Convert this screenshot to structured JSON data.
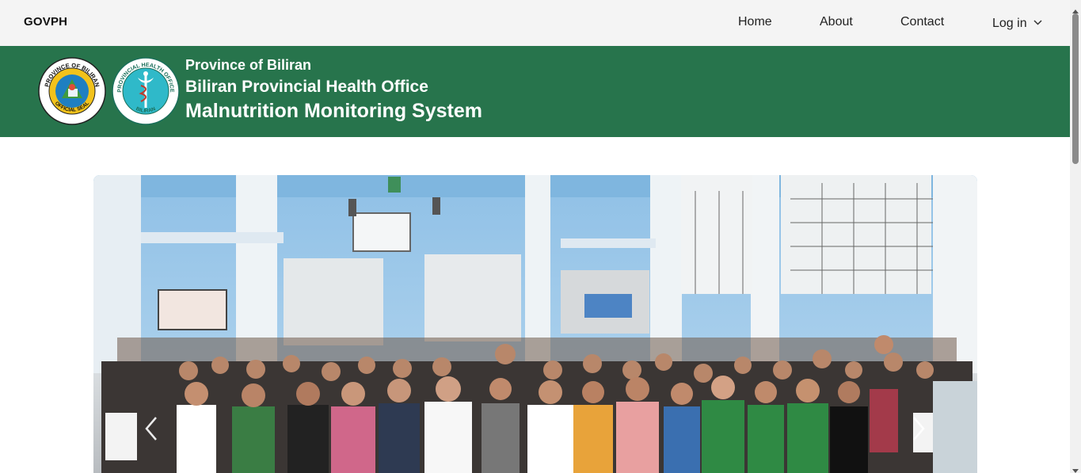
{
  "nav": {
    "brand": "GOVPH",
    "links": [
      {
        "label": "Home"
      },
      {
        "label": "About"
      },
      {
        "label": "Contact"
      }
    ],
    "login_label": "Log in"
  },
  "header": {
    "line1": "Province of Biliran",
    "line2": "Biliran Provincial Health Office",
    "line3": "Malnutrition Monitoring System",
    "seal1": {
      "icon": "province-of-biliran-official-seal",
      "text_top": "PROVINCE OF BILIRAN",
      "text_bottom": "OFFICIAL SEAL"
    },
    "seal2": {
      "icon": "provincial-health-office-seal",
      "text_top": "PROVINCIAL HEALTH OFFICE",
      "text_bottom": "BILIRAN"
    },
    "color": "#27744c"
  },
  "carousel": {
    "prev_icon": "chevron-left-icon",
    "next_icon": "chevron-right-icon"
  }
}
